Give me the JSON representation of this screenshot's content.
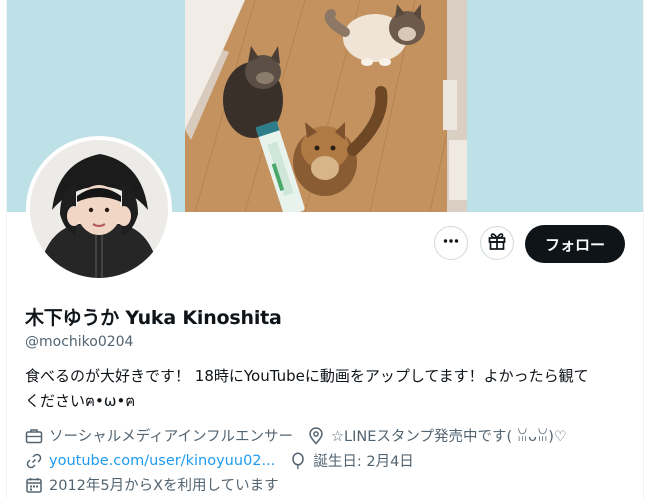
{
  "profile": {
    "display_name": "木下ゆうか Yuka Kinoshita",
    "handle": "@mochiko0204",
    "bio_line1": "食べるのが大好きです！ 18時にYouTubeに動画をアップしてます！よかったら観て",
    "bio_line2": "くださいฅ•ω•ฅ",
    "category": "ソーシャルメディアインフルエンサー",
    "location": "☆LINEスタンプ発売中です( ꈍᴗꈍ)♡",
    "website": "youtube.com/user/kinoyuu02...",
    "birthday": "誕生日: 2月4日",
    "joined": "2012年5月からXを利用しています"
  },
  "actions": {
    "follow_label": "フォロー",
    "more_icon": "more-horizontal-icon",
    "gift_icon": "gift-icon"
  },
  "icons": {
    "category": "briefcase-icon",
    "location": "location-pin-icon",
    "website": "link-icon",
    "birthday": "balloon-icon",
    "joined": "calendar-icon"
  },
  "colors": {
    "banner": "#bde1e6",
    "link": "#1d9bf0",
    "secondary_text": "#536471",
    "follow_button": "#0f1419"
  }
}
